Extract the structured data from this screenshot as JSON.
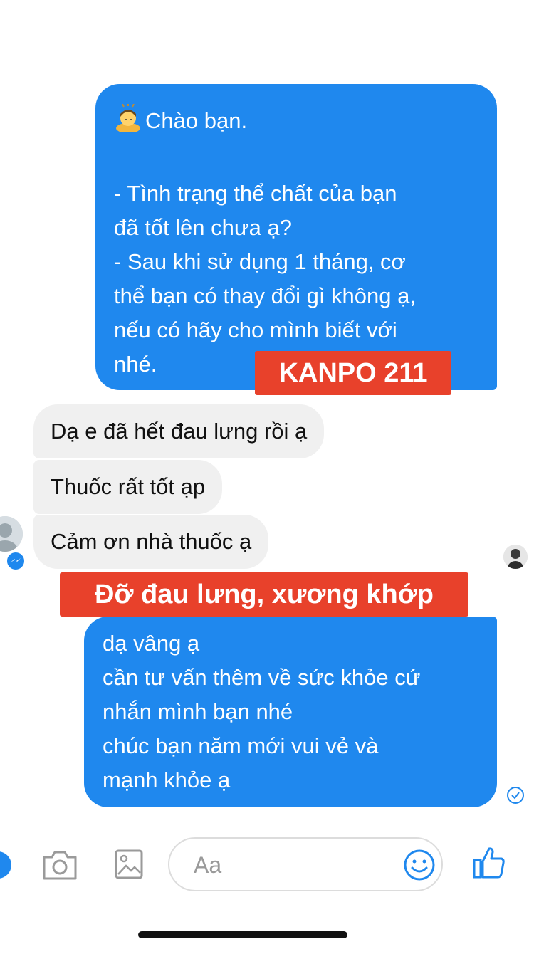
{
  "message_out_1": {
    "lines": [
      "Chào bạn.",
      "",
      "- Tình trạng thể chất của bạn",
      "đã tốt lên chưa ạ?",
      "- Sau khi sử dụng 1 tháng, cơ",
      "thể bạn có thay đổi gì không ạ,",
      "nếu có hãy cho mình biết với",
      "nhé."
    ],
    "emoji_icon": "person-bowing-icon"
  },
  "label_kanpo": "KANPO 211",
  "messages_in": [
    "Dạ e đã hết đau lưng rồi ạ",
    "Thuốc rất tốt ạp",
    "Cảm ơn nhà thuốc ạ"
  ],
  "label_benefit": "Đỡ đau lưng, xương khớp",
  "message_out_2": {
    "lines": [
      "dạ vâng ạ",
      "cần tư vấn thêm về sức khỏe cứ",
      "nhắn mình bạn nhé",
      "chúc bạn năm mới vui vẻ và",
      "mạnh khỏe ạ"
    ]
  },
  "composer": {
    "placeholder": "Aa"
  },
  "colors": {
    "bubble_out": "#1f88ee",
    "bubble_in": "#f0f0f0",
    "label": "#e8412b",
    "icon_blue": "#1f88ee"
  }
}
